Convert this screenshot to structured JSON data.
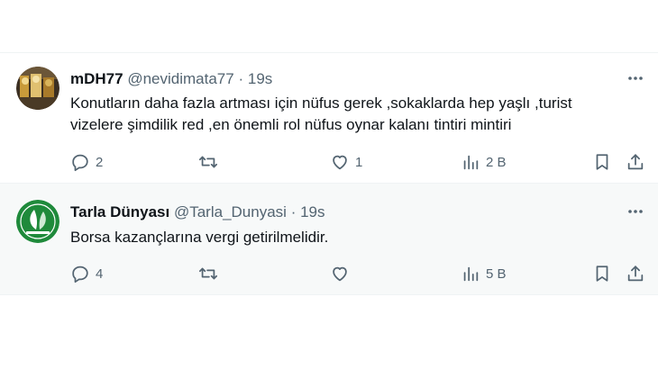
{
  "tweets": [
    {
      "name": "mDH77",
      "handle": "@nevidimata77",
      "separator": "·",
      "time": "19s",
      "text": "Konutların daha fazla artması için nüfus gerek ,sokaklarda hep yaşlı ,turist\nvizelere şimdilik red ,en önemli rol nüfus oynar kalanı tintiri mintiri",
      "replies": "2",
      "retweets": "",
      "likes": "1",
      "views": "2 B",
      "avatar_icon": "photo-avatar"
    },
    {
      "name": "Tarla Dünyası",
      "handle": "@Tarla_Dunyasi",
      "separator": "·",
      "time": "19s",
      "text": "Borsa kazançlarına vergi getirilmelidir.",
      "replies": "4",
      "retweets": "",
      "likes": "",
      "views": "5 B",
      "avatar_icon": "leaf-logo-avatar"
    }
  ],
  "icons": {
    "reply": "reply-icon",
    "retweet": "retweet-icon",
    "like": "heart-icon",
    "views": "views-icon",
    "bookmark": "bookmark-icon",
    "share": "share-icon",
    "more": "more-icon"
  },
  "colors": {
    "text_primary": "#0f1419",
    "text_secondary": "#536471",
    "highlight_background": "#f7f9f9",
    "logo_green": "#1f8a3b"
  }
}
